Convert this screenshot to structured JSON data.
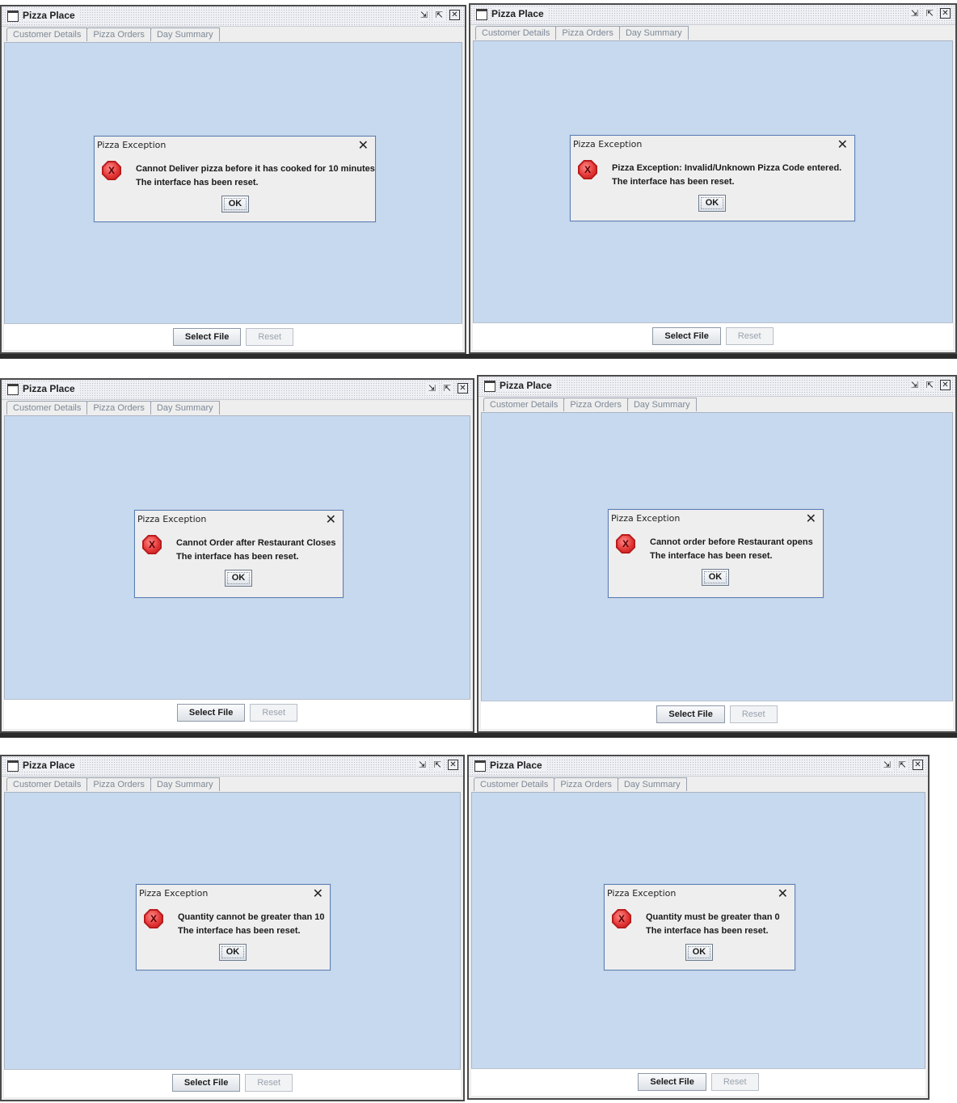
{
  "app": {
    "title": "Pizza Place",
    "tabs": [
      "Customer Details",
      "Pizza Orders",
      "Day Summary"
    ],
    "buttons": {
      "select_file": "Select File",
      "reset": "Reset"
    },
    "window_controls": [
      "restore-icon",
      "maximize-icon",
      "close-icon"
    ]
  },
  "dialog": {
    "title": "Pizza Exception",
    "ok_label": "OK",
    "close_glyph": "✕",
    "icon": "error-icon"
  },
  "panels": [
    {
      "message": "Cannot Deliver pizza before it has cooked for 10 minutes",
      "submessage": "The interface has been reset."
    },
    {
      "message": "Pizza Exception: Invalid/Unknown Pizza Code entered.",
      "submessage": "The interface has been reset."
    },
    {
      "message": "Cannot Order after Restaurant Closes",
      "submessage": "The interface has been reset."
    },
    {
      "message": "Cannot order before Restaurant opens",
      "submessage": "The interface has been reset."
    },
    {
      "message": "Quantity cannot be greater than 10",
      "submessage": "The interface has been reset."
    },
    {
      "message": "Quantity must be greater than 0",
      "submessage": "The interface has been reset."
    }
  ],
  "colors": {
    "content_bg": "#c6d9ef",
    "error_red": "#d42a2a",
    "dialog_border": "#5a7fb8"
  }
}
